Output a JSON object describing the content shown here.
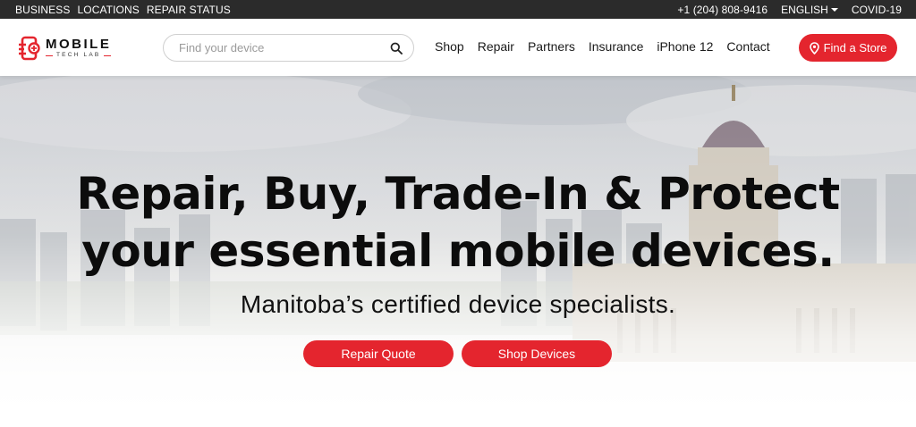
{
  "topbar": {
    "links": [
      "BUSINESS",
      "LOCATIONS",
      "REPAIR STATUS"
    ],
    "phone": "+1 (204) 808-9416",
    "language": "ENGLISH",
    "covid": "COVID-19"
  },
  "header": {
    "logo": {
      "main": "MOBILE",
      "sub": "TECH LAB"
    },
    "search": {
      "placeholder": "Find your device",
      "value": ""
    },
    "nav": [
      "Shop",
      "Repair",
      "Partners",
      "Insurance",
      "iPhone 12",
      "Contact"
    ],
    "cta_label": "Find a Store"
  },
  "hero": {
    "title_line1": "Repair, Buy, Trade-In & Protect",
    "title_line2": "your essential mobile devices.",
    "subtitle": "Manitoba’s certified device specialists.",
    "buttons": {
      "repair_quote": "Repair Quote",
      "shop_devices": "Shop Devices"
    }
  },
  "colors": {
    "brand_red": "#e4252e",
    "topbar_bg": "#2b2b2b",
    "text_dark": "#0c0c0c"
  },
  "icons": {
    "search": "search-icon",
    "location": "map-pin-icon",
    "language_caret": "caret-down-icon",
    "logo": "logo-mark-icon"
  }
}
